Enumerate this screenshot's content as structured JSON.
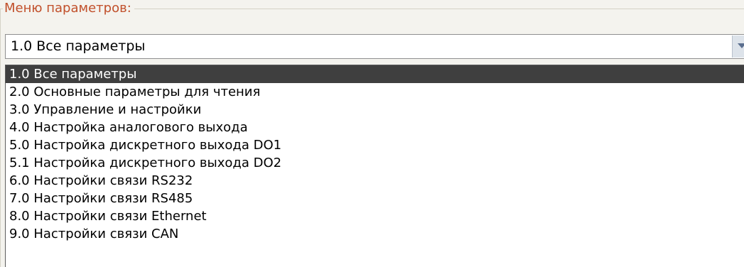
{
  "group": {
    "label": "Меню параметров:"
  },
  "combo": {
    "selected": "1.0 Все параметры"
  },
  "dropdown": {
    "items": [
      {
        "label": "1.0 Все параметры",
        "selected": true
      },
      {
        "label": "2.0 Основные параметры для чтения",
        "selected": false
      },
      {
        "label": "3.0 Управление и настройки",
        "selected": false
      },
      {
        "label": "4.0 Настройка аналогового выхода",
        "selected": false
      },
      {
        "label": "5.0 Настройка дискретного выхода DO1",
        "selected": false
      },
      {
        "label": "5.1 Настройка дискретного выхода DO2",
        "selected": false
      },
      {
        "label": "6.0 Настройки связи RS232",
        "selected": false
      },
      {
        "label": "7.0 Настройки связи RS485",
        "selected": false
      },
      {
        "label": "8.0 Настройки связи Ethernet",
        "selected": false
      },
      {
        "label": "9.0 Настройки связи CAN",
        "selected": false
      }
    ]
  },
  "colors": {
    "label_accent": "#c1502b",
    "selection_background": "#3f3f3f"
  },
  "icons": {
    "combo_arrow": "chevron-down-icon"
  }
}
